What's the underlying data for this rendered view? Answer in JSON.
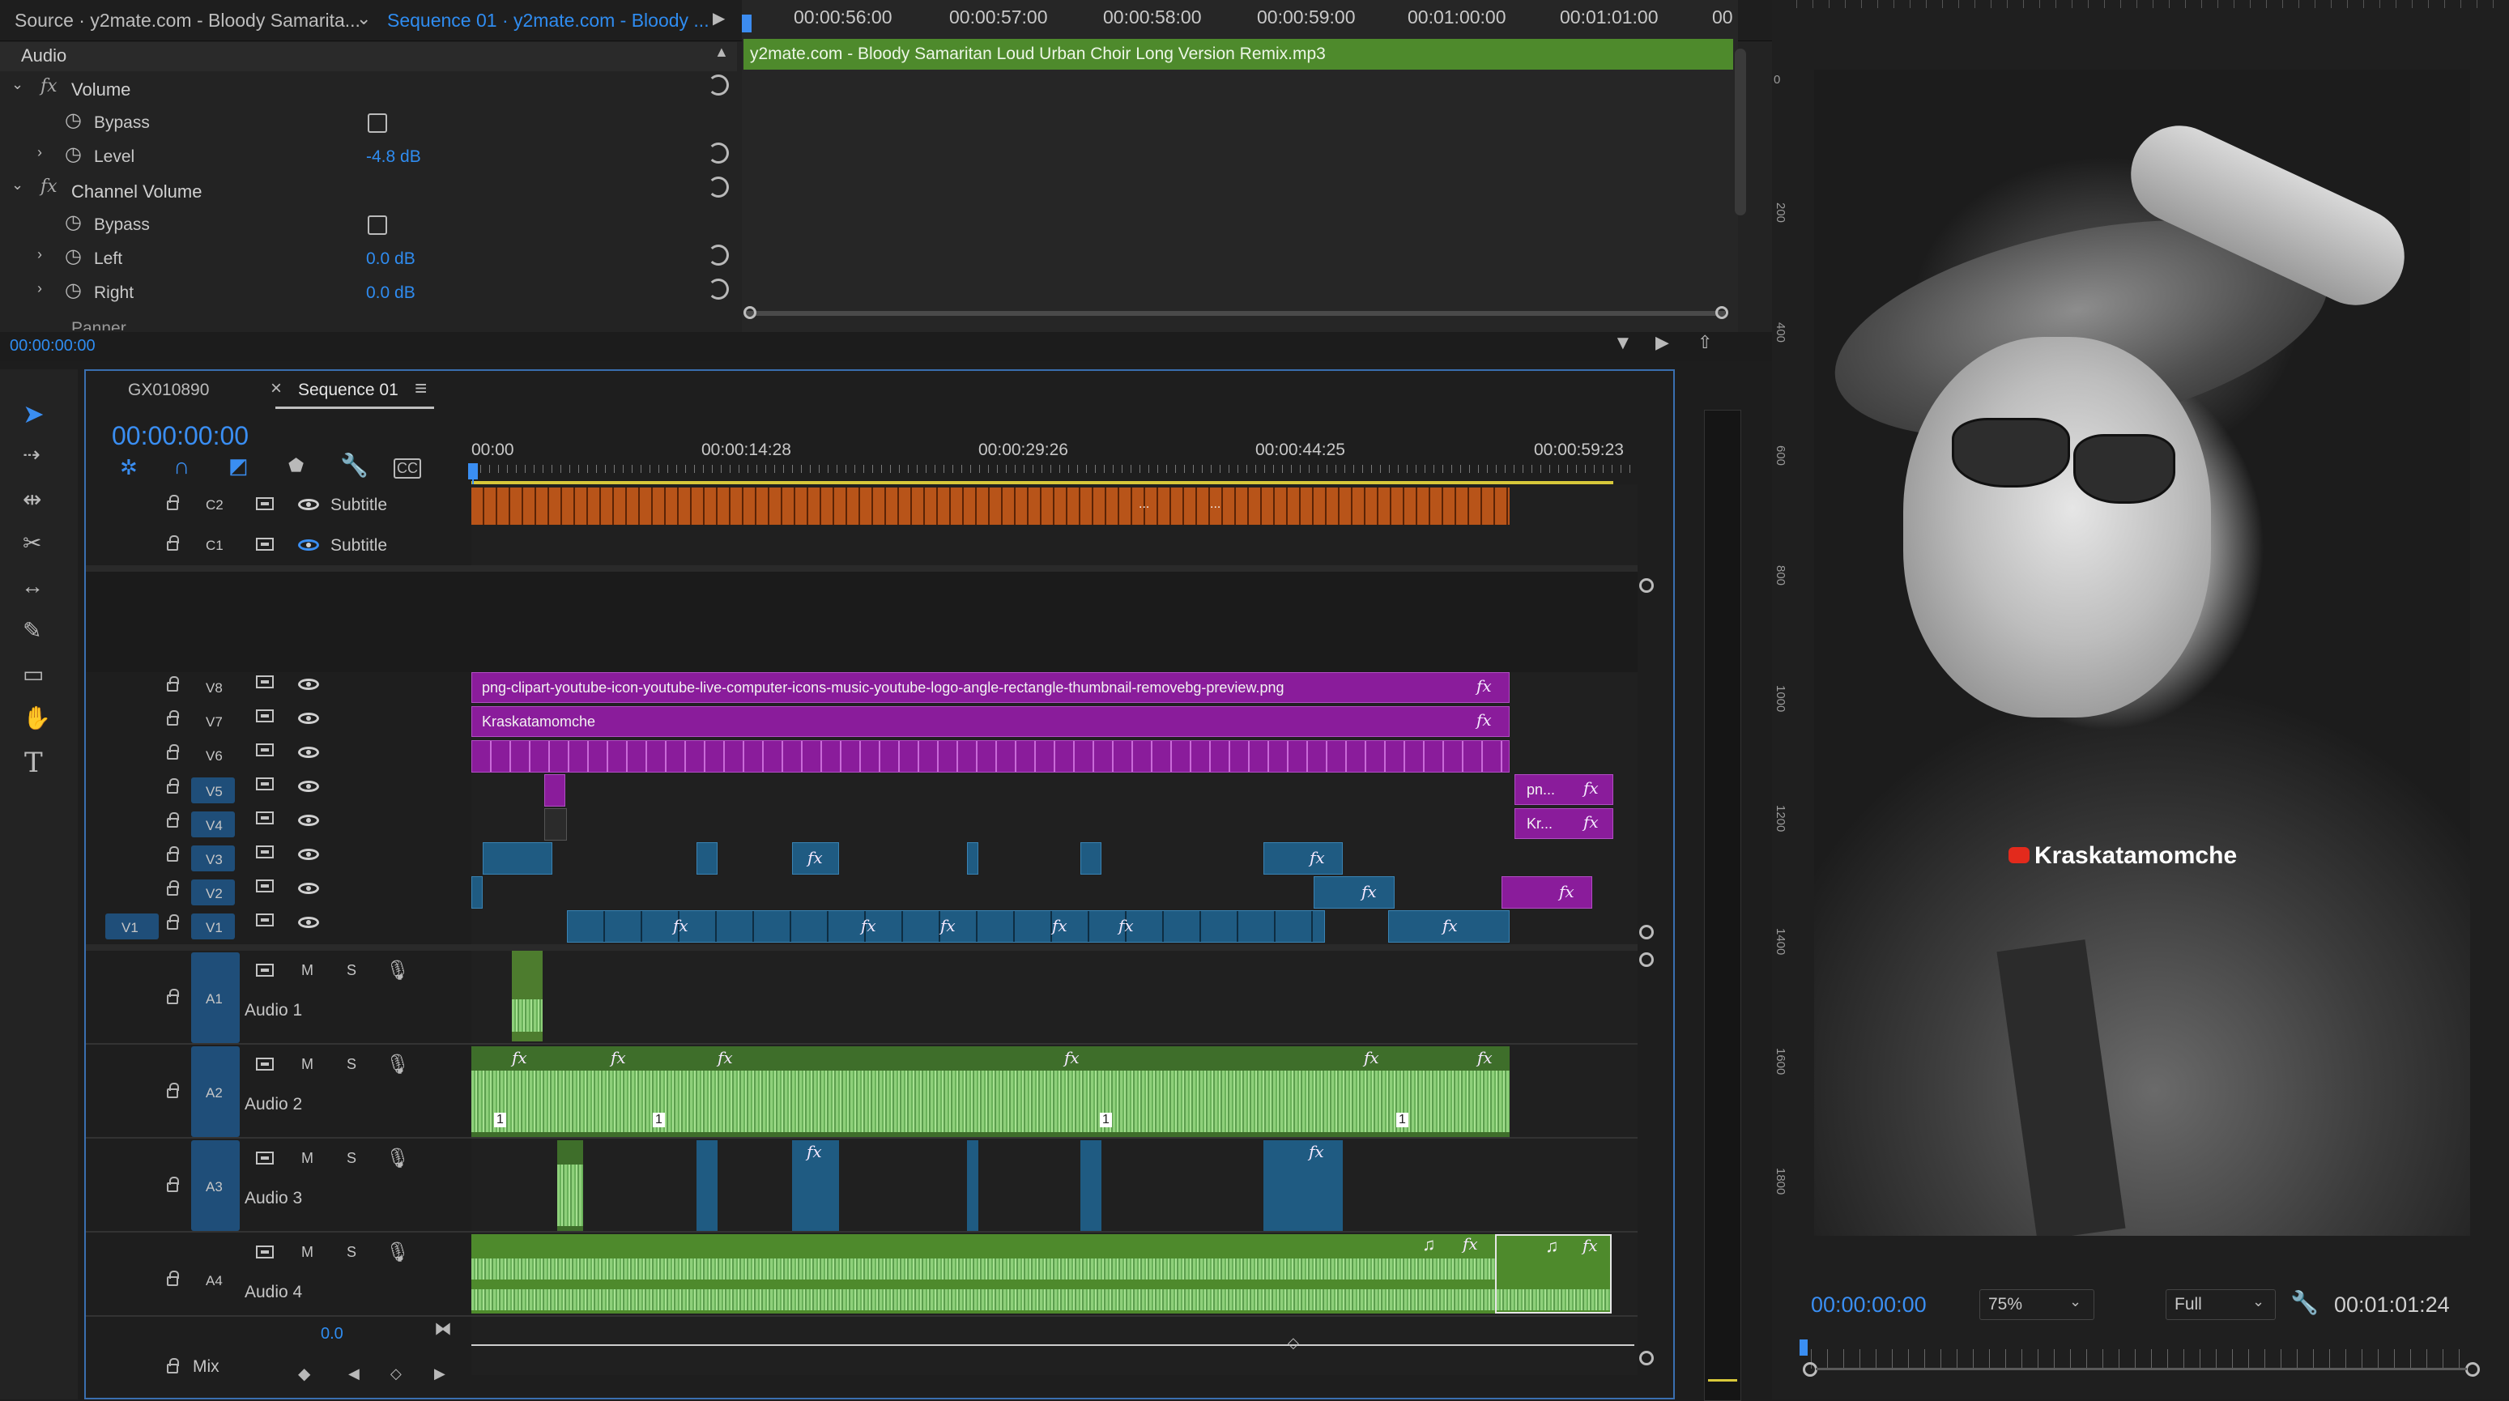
{
  "source_panel": {
    "source_tab": "Source · y2mate.com - Bloody Samarita...",
    "sequence_tab": "Sequence 01 · y2mate.com - Bloody ...",
    "section": "Audio",
    "effects": [
      {
        "name": "Volume",
        "props": [
          {
            "label": "Bypass",
            "type": "checkbox"
          },
          {
            "label": "Level",
            "value": "-4.8 dB"
          }
        ]
      },
      {
        "name": "Channel Volume",
        "props": [
          {
            "label": "Bypass",
            "type": "checkbox"
          },
          {
            "label": "Left",
            "value": "0.0 dB"
          },
          {
            "label": "Right",
            "value": "0.0 dB"
          }
        ]
      }
    ],
    "cut_label": "Panner",
    "timecode": "00:00:00:00",
    "ruler": [
      "00:00:56:00",
      "00:00:57:00",
      "00:00:58:00",
      "00:00:59:00",
      "00:01:00:00",
      "00:01:01:00",
      "00"
    ],
    "clip_name": "y2mate.com - Bloody Samaritan  Loud Urban Choir Long Version Remix.mp3"
  },
  "timeline": {
    "tabs": [
      {
        "label": "GX010890"
      },
      {
        "label": "Sequence 01"
      }
    ],
    "close_symbol": "×",
    "menu_symbol": "≡",
    "timecode": "00:00:00:00",
    "ruler": [
      "00:00",
      "00:00:14:28",
      "00:00:29:26",
      "00:00:44:25",
      "00:00:59:23"
    ],
    "caption_tracks": [
      {
        "id": "C2",
        "name": "Subtitle"
      },
      {
        "id": "C1",
        "name": "Subtitle"
      }
    ],
    "video_tracks": [
      "V8",
      "V7",
      "V6",
      "V5",
      "V4",
      "V3",
      "V2",
      "V1"
    ],
    "source_patch": "V1",
    "audio_tracks": [
      {
        "id": "A1",
        "name": "Audio 1"
      },
      {
        "id": "A2",
        "name": "Audio 2"
      },
      {
        "id": "A3",
        "name": "Audio 3"
      },
      {
        "id": "A4",
        "name": "Audio 4"
      }
    ],
    "mix_label": "Mix",
    "mix_value": "0.0",
    "mute_label": "M",
    "solo_label": "S",
    "clips": {
      "v8": "png-clipart-youtube-icon-youtube-live-computer-icons-music-youtube-logo-angle-rectangle-thumbnail-removebg-preview.png",
      "v7": "Kraskatamomche",
      "v5_short": "pn...",
      "v4_short": "Kr...",
      "fx": "fx",
      "ellipsis": "...",
      "num": "1"
    }
  },
  "program": {
    "overlay_text": "Kraskatamomche",
    "timecode": "00:00:00:00",
    "zoom": "75%",
    "resolution": "Full",
    "duration": "00:01:01:24",
    "ruler_labels": [
      "0",
      "200",
      "400",
      "600",
      "800",
      "1000",
      "1200",
      "1400",
      "1600",
      "1800"
    ]
  },
  "tools": [
    "selection-tool",
    "track-select-tool",
    "ripple-edit-tool",
    "razor-tool",
    "slip-tool",
    "pen-tool",
    "rectangle-tool",
    "hand-tool",
    "type-tool"
  ],
  "colors": {
    "accent": "#2f8cf0",
    "video_clip": "#8a1c9b",
    "video_clip_blue": "#1f5b82",
    "audio_clip": "#3c7a2f",
    "subtitle_clip": "#b85419"
  }
}
